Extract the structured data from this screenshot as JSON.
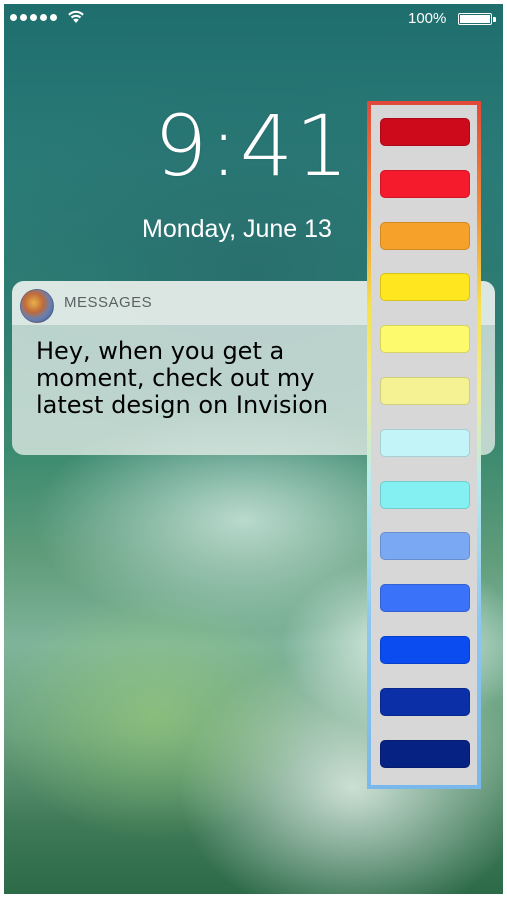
{
  "status_bar": {
    "signal_dots": 5,
    "battery_percent": "100%",
    "battery_level": 1.0
  },
  "lockscreen": {
    "time": "9:41",
    "date": "Monday, June 13"
  },
  "notification": {
    "app_name": "MESSAGES",
    "app_icon": "messages-app-icon",
    "message": "Hey, when you get a moment, check out my latest design on Invision"
  },
  "color_palette": {
    "swatches": [
      {
        "name": "dark-red",
        "color": "#cc0a1c"
      },
      {
        "name": "red",
        "color": "#f51a2c"
      },
      {
        "name": "orange",
        "color": "#f5a12a"
      },
      {
        "name": "yellow",
        "color": "#ffe61e"
      },
      {
        "name": "light-yellow",
        "color": "#fdfa6e"
      },
      {
        "name": "pale-yellow",
        "color": "#f5f293"
      },
      {
        "name": "pale-cyan",
        "color": "#c2f4f8"
      },
      {
        "name": "cyan",
        "color": "#84f0f2"
      },
      {
        "name": "light-blue",
        "color": "#7aa8f2"
      },
      {
        "name": "blue",
        "color": "#3b72fa"
      },
      {
        "name": "bright-blue",
        "color": "#0a4cf0"
      },
      {
        "name": "dark-blue",
        "color": "#0a2fa6"
      },
      {
        "name": "navy",
        "color": "#062283"
      }
    ]
  }
}
